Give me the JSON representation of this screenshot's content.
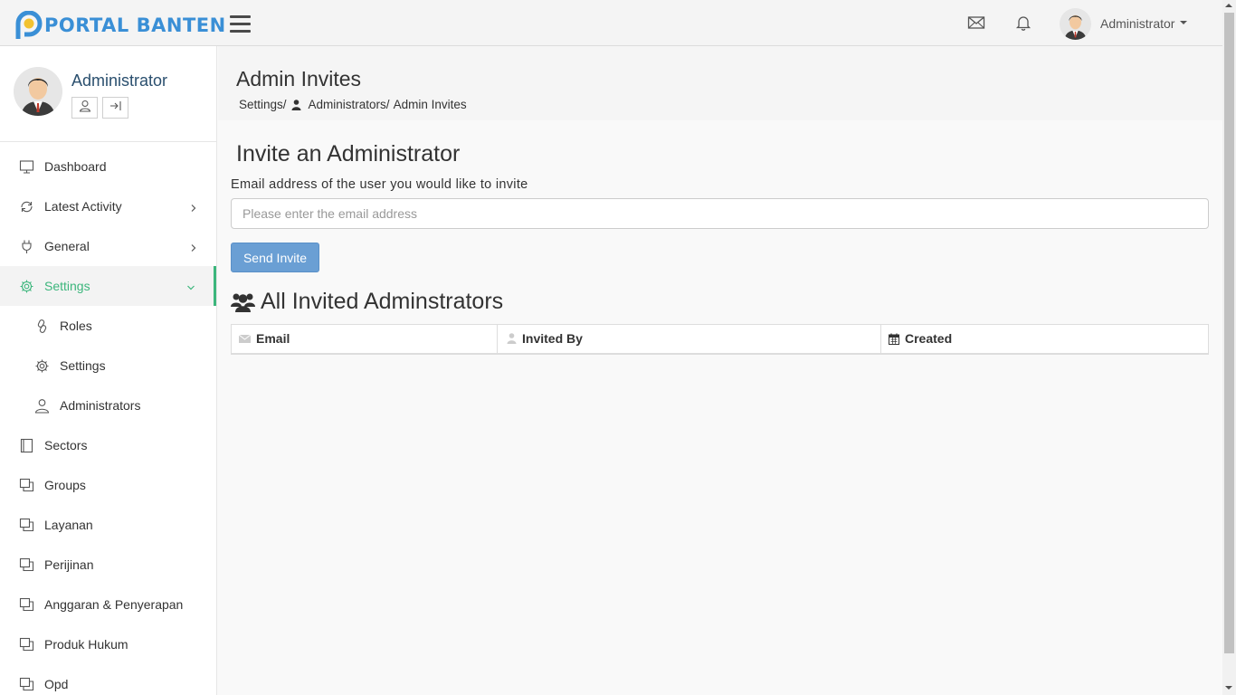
{
  "app": {
    "logo_text": "PORTAL BANTEN",
    "brand_color": "#3a8fd6",
    "accent_color": "#3cb67c"
  },
  "topbar": {
    "user_name": "Administrator",
    "icons": [
      "menu-icon",
      "envelope-icon",
      "bell-icon"
    ]
  },
  "sidebar": {
    "profile_name": "Administrator",
    "items": [
      {
        "label": "Dashboard",
        "icon": "monitor-icon"
      },
      {
        "label": "Latest Activity",
        "icon": "refresh-icon",
        "expandable": true
      },
      {
        "label": "General",
        "icon": "plug-icon",
        "expandable": true
      },
      {
        "label": "Settings",
        "icon": "gear-icon",
        "expandable": true,
        "active": true
      },
      {
        "label": "Roles",
        "icon": "link-icon",
        "sub": true
      },
      {
        "label": "Settings",
        "icon": "gear-icon",
        "sub": true
      },
      {
        "label": "Administrators",
        "icon": "user-icon",
        "sub": true
      },
      {
        "label": "Sectors",
        "icon": "book-icon"
      },
      {
        "label": "Groups",
        "icon": "windows-icon"
      },
      {
        "label": "Layanan",
        "icon": "windows-icon"
      },
      {
        "label": "Perijinan",
        "icon": "windows-icon"
      },
      {
        "label": "Anggaran & Penyerapan",
        "icon": "windows-icon"
      },
      {
        "label": "Produk Hukum",
        "icon": "windows-icon"
      },
      {
        "label": "Opd",
        "icon": "windows-icon"
      }
    ]
  },
  "page": {
    "title": "Admin Invites",
    "breadcrumb": [
      "Settings/",
      "Administrators/",
      "Admin Invites"
    ]
  },
  "invite_form": {
    "heading": "Invite an Administrator",
    "label": "Email address of the user you would like to invite",
    "placeholder": "Please enter the email address",
    "value": "",
    "button": "Send Invite"
  },
  "invites_table": {
    "heading": "All Invited Adminstrators",
    "columns": [
      {
        "label": "Email",
        "icon": "envelope-icon"
      },
      {
        "label": "Invited By",
        "icon": "user-icon"
      },
      {
        "label": "Created",
        "icon": "calendar-icon"
      }
    ],
    "rows": []
  }
}
